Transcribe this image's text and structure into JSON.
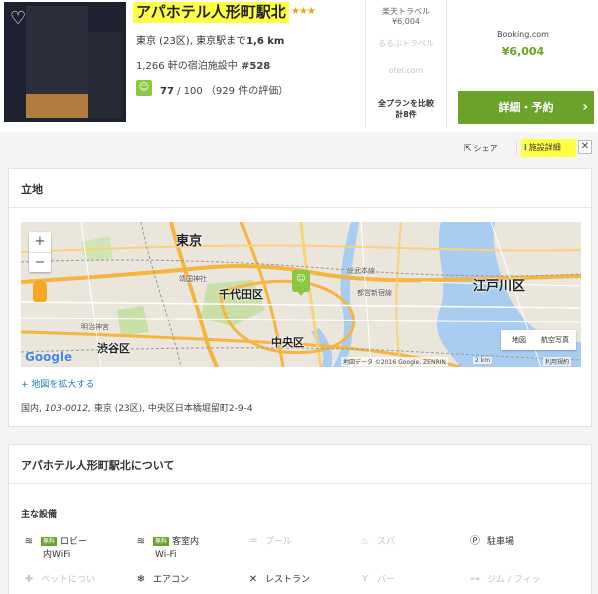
{
  "hotel": {
    "name": "アパホテル人形町駅北",
    "stars": "★★★",
    "meta_prefix": "東京 (23区), 東京駅まで",
    "distance": "1,6 km",
    "rank_prefix": "1,266 軒の宿泊施設中",
    "rank": "#528",
    "score": "77",
    "score_suffix": "/ 100 （929 件の評価）",
    "smile": "☺"
  },
  "deals": {
    "provider1": "楽天トラベル",
    "provider1_price": "¥6,004",
    "provider2": "るるぶトラベル",
    "provider3": "otel.com",
    "compare_line1": "全プランを比較",
    "compare_line2": "計8件",
    "best_provider": "Booking.com",
    "best_price": "¥6,004",
    "cta_label": "詳細・予約",
    "cta_arrow": "›"
  },
  "actions": {
    "share_label": "シェア",
    "detail_label": "施設詳細",
    "close": "✕"
  },
  "location": {
    "title": "立地",
    "enlarge_link": "+ 地図を拡大する",
    "address_prefix": "国内,",
    "postal": "103-0012,",
    "address_rest": "東京 (23区), 中央区日本橋堀留町2-9-4",
    "map": {
      "zoom_in": "+",
      "zoom_out": "−",
      "type_map": "地図",
      "type_satellite": "航空写真",
      "google": "Google",
      "attribution": "地図データ ©2016 Google, ZENRIN",
      "scale": "2 km",
      "terms": "利用規約",
      "labels": {
        "tokyo": "東京",
        "chiyoda": "千代田区",
        "chuo": "中央区",
        "shibuya": "渋谷区",
        "edogawa": "江戸川区",
        "sobu": "総武本線",
        "shinjuku_line": "都営新宿線",
        "meiji": "明治神宮",
        "yasukuni": "靖国神社"
      }
    }
  },
  "about": {
    "title": "アパホテル人形町駅北について",
    "facilities_title": "主な設備",
    "free_tag": "無料",
    "facilities": [
      {
        "icon": "wifi-icon",
        "glyph": "≋",
        "line1": "ロビー",
        "line2": "内WiFi"
      },
      {
        "icon": "wifi-icon",
        "glyph": "≋",
        "line1": "客室内",
        "line2": "Wi-Fi"
      },
      {
        "icon": "pool-icon",
        "glyph": "♒",
        "line1": "プール"
      },
      {
        "icon": "spa-icon",
        "glyph": "♨",
        "line1": "スパ"
      },
      {
        "icon": "parking-icon",
        "glyph": "Ⓟ",
        "line1": "駐車場"
      },
      {
        "icon": "pet-icon",
        "glyph": "✚",
        "line1": "ペットについ"
      },
      {
        "icon": "aircon-icon",
        "glyph": "❄",
        "line1": "エアコン"
      },
      {
        "icon": "restaurant-icon",
        "glyph": "✕",
        "line1": "レストラン"
      },
      {
        "icon": "bar-icon",
        "glyph": "Y",
        "line1": "バー"
      },
      {
        "icon": "gym-icon",
        "glyph": "⊶",
        "line1": "ジム / フィッ"
      }
    ]
  },
  "colors": {
    "highlight": "#ffff44",
    "green": "#6aa22a",
    "link": "#1c7ac2"
  }
}
